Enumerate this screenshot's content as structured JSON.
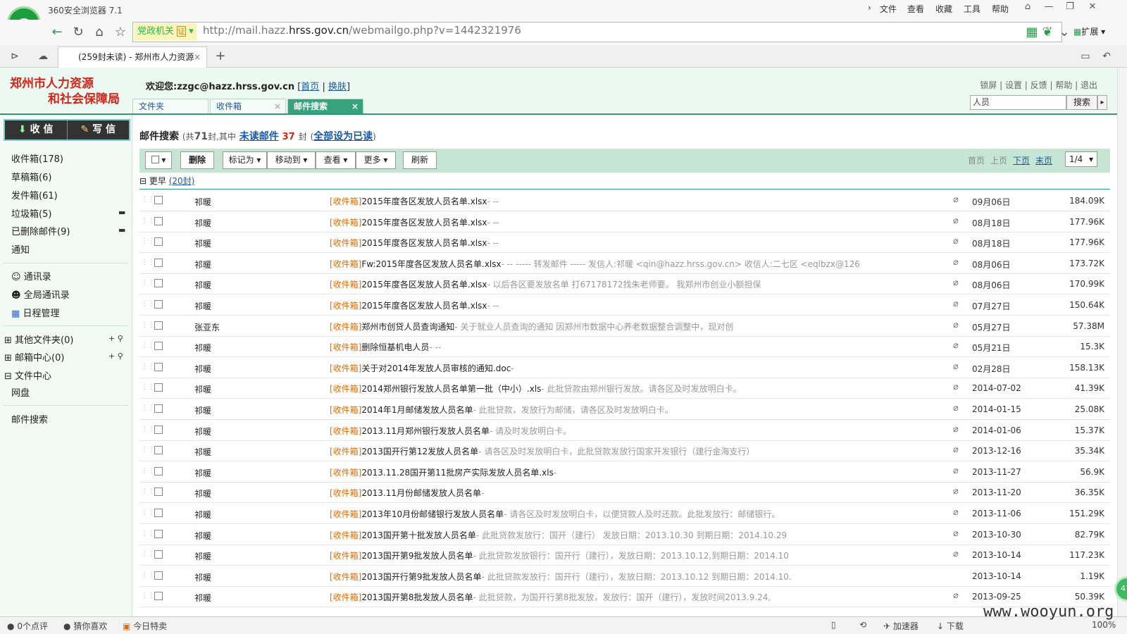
{
  "browser": {
    "brand": "360安全浏览器 7.1",
    "menus": [
      "文件",
      "查看",
      "收藏",
      "工具",
      "帮助"
    ],
    "gov_badge": "党政机关",
    "url_prefix": "http://mail.hazz.",
    "url_host": "hrss.gov.cn",
    "url_suffix": "/webmailgo.php?v=1442321976",
    "extend": "扩展",
    "tab_title": "(259封未读) - 郑州市人力资源"
  },
  "header": {
    "org_line1": "郑州市人力资源",
    "org_line2": "和社会保障局",
    "welcome": "欢迎您:zzgc@hazz.hrss.gov.cn",
    "home": "首页",
    "skin": "换肤",
    "links": "锁屏 | 设置 | 反馈 | 帮助 | 退出",
    "tabs": [
      "文件夹",
      "收件箱",
      "邮件搜索"
    ],
    "search_value": "人员",
    "search_btn": "搜索"
  },
  "sidebar": {
    "recv": "收 信",
    "write": "写 信",
    "folders": [
      "收件箱(178)",
      "草稿箱(6)",
      "发件箱(61)",
      "垃圾箱(5)",
      "已删除邮件(9)",
      "通知"
    ],
    "tools": [
      "通讯录",
      "全局通讯录",
      "日程管理"
    ],
    "groups": [
      "其他文件夹(0)",
      "邮箱中心(0)",
      "文件中心",
      "网盘"
    ],
    "search": "邮件搜索"
  },
  "main": {
    "title": "邮件搜索",
    "summary_a": "(共",
    "total": "71",
    "summary_b": "封,其中",
    "unread_link": "未读邮件",
    "unread": "37",
    "summary_c": "封",
    "readall": "全部设为已读",
    "toolbar": [
      "删除",
      "标记为 ▾",
      "移动到 ▾",
      "查看 ▾",
      "更多 ▾",
      "刷新"
    ],
    "pager": [
      "首页",
      "上页",
      "下页",
      "末页"
    ],
    "page": "1/4",
    "group": "更早",
    "group_count": "(20封)"
  },
  "rows": [
    {
      "from": "祁暖",
      "folder": "[收件箱]",
      "subject": "2015年度各区发放人员名单.xlsx",
      "preview": "- --",
      "date": "09月06日",
      "size": "184.09K",
      "att": true
    },
    {
      "from": "祁暖",
      "folder": "[收件箱]",
      "subject": "2015年度各区发放人员名单.xlsx",
      "preview": "- --",
      "date": "08月18日",
      "size": "177.96K",
      "att": true
    },
    {
      "from": "祁暖",
      "folder": "[收件箱]",
      "subject": "2015年度各区发放人员名单.xlsx",
      "preview": "- --",
      "date": "08月18日",
      "size": "177.96K",
      "att": true
    },
    {
      "from": "祁暖",
      "folder": "[收件箱]",
      "subject": "Fw:2015年度各区发放人员名单.xlsx",
      "preview": "- -- ----- 转发邮件 ----- 发信人:祁暖 <qin@hazz.hrss.gov.cn> 收信人:二七区 <eqlbzx@126",
      "date": "08月06日",
      "size": "173.72K",
      "att": true
    },
    {
      "from": "祁暖",
      "folder": "[收件箱]",
      "subject": "2015年度各区发放人员名单.xlsx",
      "preview": "-    以后各区要发放名单 打67178172找朱老师要。    我郑州市创业小额担保",
      "date": "08月06日",
      "size": "170.99K",
      "att": true
    },
    {
      "from": "祁暖",
      "folder": "[收件箱]",
      "subject": "2015年度各区发放人员名单.xlsx",
      "preview": "- --",
      "date": "07月27日",
      "size": "150.64K",
      "att": true
    },
    {
      "from": "张亚东",
      "folder": "[收件箱]",
      "subject": "郑州市创贷人员查询通知",
      "preview": "- 关于就业人员查询的通知 因郑州市数据中心养老数据整合调整中，现对创",
      "date": "05月27日",
      "size": "57.38M",
      "att": true
    },
    {
      "from": "祁暖",
      "folder": "[收件箱]",
      "subject": "删除恒基机电人员",
      "preview": "- --",
      "date": "05月21日",
      "size": "15.3K",
      "att": true
    },
    {
      "from": "祁暖",
      "folder": "[收件箱]",
      "subject": "关于对2014年发放人员审核的通知.doc",
      "preview": "-",
      "date": "02月28日",
      "size": "158.13K",
      "att": true
    },
    {
      "from": "祁暖",
      "folder": "[收件箱]",
      "subject": "2014郑州银行发放人员名单第一批（中小）.xls",
      "preview": "- 此批贷款由郑州银行发放。请各区及时发放明白卡。",
      "date": "2014-07-02",
      "size": "41.39K",
      "att": true
    },
    {
      "from": "祁暖",
      "folder": "[收件箱]",
      "subject": "2014年1月邮储发放人员名单",
      "preview": "- 此批贷款，发放行为邮储，请各区及时发放明白卡。",
      "date": "2014-01-15",
      "size": "25.08K",
      "att": true
    },
    {
      "from": "祁暖",
      "folder": "[收件箱]",
      "subject": "2013.11月郑州银行发放人员名单",
      "preview": "- 请及时发放明白卡。",
      "date": "2014-01-06",
      "size": "15.37K",
      "att": true
    },
    {
      "from": "祁暖",
      "folder": "[收件箱]",
      "subject": "2013国开行第12发放人员名单",
      "preview": "- 请各区及时发放明白卡，此批贷款发放行国家开发银行（建行金海支行）",
      "date": "2013-12-16",
      "size": "35.34K",
      "att": true
    },
    {
      "from": "祁暖",
      "folder": "[收件箱]",
      "subject": "2013.11.28国开第11批房产实际发放人员名单.xls",
      "preview": "-",
      "date": "2013-11-27",
      "size": "56.9K",
      "att": true
    },
    {
      "from": "祁暖",
      "folder": "[收件箱]",
      "subject": "2013.11月份邮储发放人员名单",
      "preview": "-",
      "date": "2013-11-20",
      "size": "36.35K",
      "att": true
    },
    {
      "from": "祁暖",
      "folder": "[收件箱]",
      "subject": "2013年10月份邮储银行发放人员名单",
      "preview": "- 请各区及时发放明白卡，以便贷款人及时还款。此批发放行：邮储银行。",
      "date": "2013-11-06",
      "size": "151.29K",
      "att": true
    },
    {
      "from": "祁暖",
      "folder": "[收件箱]",
      "subject": "2013国开第十批发放人员名单",
      "preview": "- 此批贷款发放行：国开（建行）  发放日期：2013.10.30  到期日期：2014.10.29",
      "date": "2013-10-30",
      "size": "82.79K",
      "att": true
    },
    {
      "from": "祁暖",
      "folder": "[收件箱]",
      "subject": "2013国开第9批发放人员名单",
      "preview": "- 此批贷款发放银行：国开行（建行），发放日期：2013.10.12,到期日期：2014.10",
      "date": "2013-10-14",
      "size": "117.23K",
      "att": true
    },
    {
      "from": "祁暖",
      "folder": "[收件箱]",
      "subject": "2013国开行第9批发放人员名单",
      "preview": "- 此批贷款发放行：国开行（建行），发放日期：2013.10.12 到期日期：2014.10.",
      "date": "2013-10-14",
      "size": "1.19K",
      "att": false
    },
    {
      "from": "祁暖",
      "folder": "[收件箱]",
      "subject": "2013国开第8批发放人员名单",
      "preview": "- 此批贷款，为国开行第8批发放，发放行：国开（建行），发放时间2013.9.24,",
      "date": "2013-09-25",
      "size": "50.39K",
      "att": true
    }
  ],
  "status": {
    "items": [
      "0个点评",
      "猜你喜欢",
      "今日特卖"
    ],
    "right": [
      "加速器",
      "下载",
      "100%"
    ],
    "watermark": "www.wooyun.org"
  }
}
